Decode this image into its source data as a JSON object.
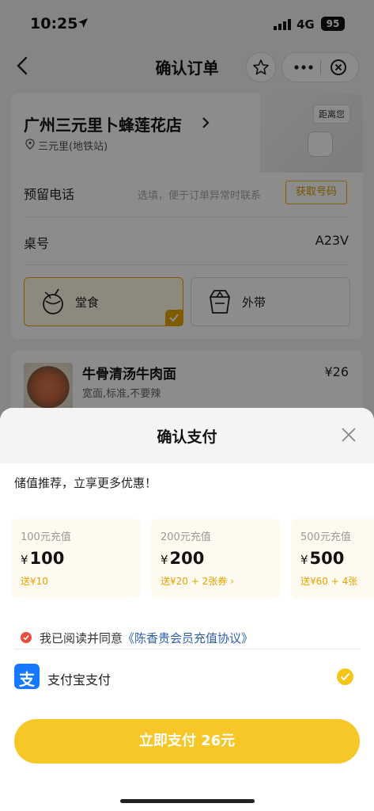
{
  "status_bar": {
    "time": "10:25",
    "network": "4G",
    "battery": "95"
  },
  "nav": {
    "title": "确认订单"
  },
  "store": {
    "name": "广州三元里卜蜂莲花店",
    "subway": "三元里(地铁站)",
    "distance_label": "距离您",
    "phone_label": "预留电话",
    "phone_placeholder": "选填，便于订单异常时联系",
    "get_number_button": "获取号码",
    "table_label": "桌号",
    "table_value": "A23V",
    "modes": [
      {
        "label": "堂食",
        "selected": true
      },
      {
        "label": "外带",
        "selected": false
      }
    ]
  },
  "order_item": {
    "name": "牛骨清汤牛肉面",
    "options": "宽面,标准,不要辣",
    "price": "¥26"
  },
  "payment_sheet": {
    "title": "确认支付",
    "promo": "储值推荐，立享更多优惠！",
    "recharge_options": [
      {
        "title": "100元充值",
        "amount": "100",
        "gift": "送¥10"
      },
      {
        "title": "200元充值",
        "amount": "200",
        "gift": "送¥20 + 2张券"
      },
      {
        "title": "500元充值",
        "amount": "500",
        "gift": "送¥60 + 4张"
      }
    ],
    "currency": "¥",
    "agreement_prefix": "我已阅读并同意",
    "agreement_link": "《陈香贵会员充值协议》",
    "method_label": "支付宝支付",
    "method_logo_char": "支",
    "pay_button": "立即支付 26元"
  },
  "colors": {
    "accent": "#f7c627",
    "brand_gold": "#e8a600",
    "alipay": "#1677ff",
    "link": "#2f5fa8"
  }
}
